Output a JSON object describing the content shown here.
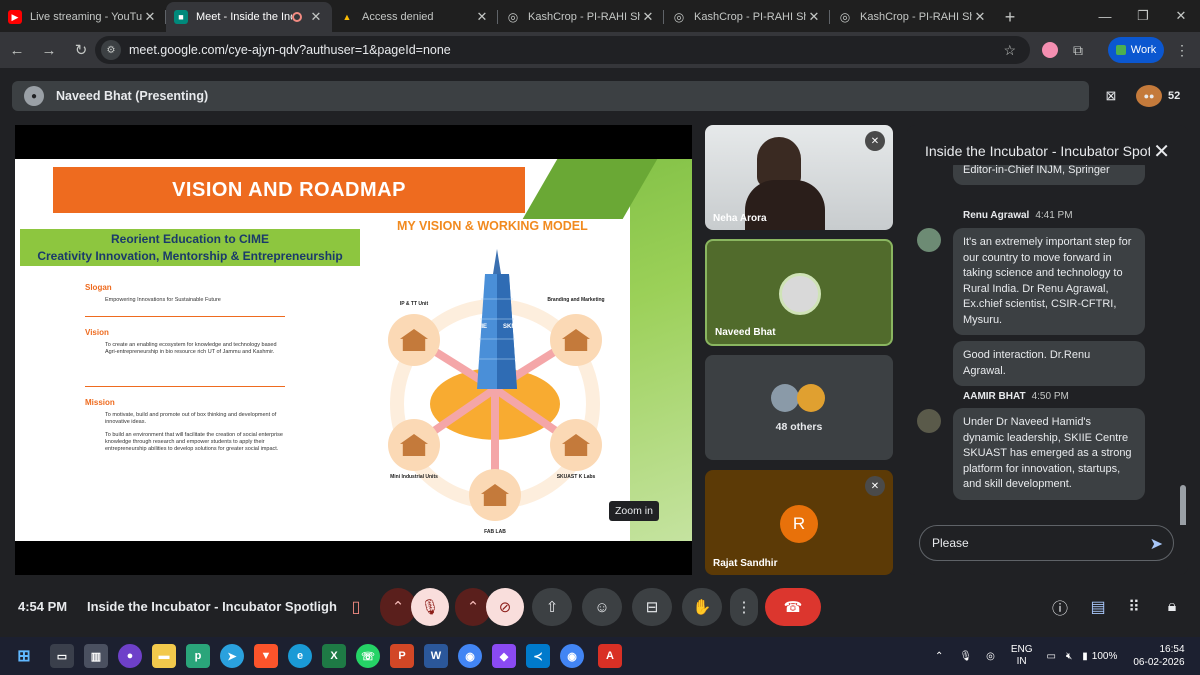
{
  "browser": {
    "tabs": [
      {
        "label": "Live streaming - YouTube Studio",
        "icon": "youtube-icon",
        "color": "#ff0000",
        "active": false
      },
      {
        "label": "Meet - Inside the Incubator",
        "icon": "meet-icon",
        "color": "#00897b",
        "active": true
      },
      {
        "label": "Access denied",
        "icon": "drive-icon",
        "color": "#fbbc04",
        "active": false
      },
      {
        "label": "KashCrop - PI-RAHI Showcase",
        "icon": "globe-icon",
        "color": "#9aa0a6",
        "active": false
      },
      {
        "label": "KashCrop - PI-RAHI Showcase",
        "icon": "globe-icon",
        "color": "#9aa0a6",
        "active": false
      },
      {
        "label": "KashCrop - PI-RAHI Showcase",
        "icon": "globe-icon",
        "color": "#9aa0a6",
        "active": false
      }
    ],
    "url": "meet.google.com/cye-ajyn-qdv?authuser=1&pageId=none",
    "profile_label": "Work"
  },
  "presenter_bar": {
    "label": "Naveed Bhat (Presenting)",
    "participant_count": "52"
  },
  "slide": {
    "title": "VISION AND ROADMAP",
    "green_line1": "Reorient Education to CIME",
    "green_line2": "Creativity Innovation, Mentorship & Entrepreneurship",
    "model_title": "MY VISION & WORKING MODEL",
    "slogan_heading": "Slogan",
    "slogan_text": "Empowering Innovations for Sustainable Future",
    "vision_heading": "Vision",
    "vision_text": "To create an enabling ecosystem for knowledge and technology based Agri-entrepreneurship in bio resource rich UT of Jammu and Kashmir.",
    "mission_heading": "Mission",
    "mission_text1": "To motivate, build and promote out of box thinking and development of innovative ideas.",
    "mission_text2": "To build an environment that will facilitate the creation of social enterprise knowledge through research and empower students to apply their entrepreneurship abilities to develop solutions for greater social impact.",
    "nodes": [
      "IP & TT Unit",
      "Branding and Marketing",
      "Mini Industrial Units",
      "SKUAST K Labs",
      "FAB LAB"
    ],
    "tower_label_left": "SKIE",
    "tower_label_right": "SKIE",
    "zoom_tooltip": "Zoom in"
  },
  "tiles": {
    "neha": "Neha Arora",
    "naveed": "Naveed Bhat",
    "others": "48 others",
    "rajat": "Rajat Sandhir",
    "rajat_initial": "R"
  },
  "chat": {
    "title": "Inside the Incubator - Incubator Spotlight",
    "prev_tail": "Editor-in-Chief INJM, Springer",
    "messages": [
      {
        "sender": "Renu Agrawal",
        "time": "4:41 PM",
        "text": "It's an extremely important step for our country to move forward in taking science and technology to Rural India. Dr Renu Agrawal, Ex.chief scientist,  CSIR-CFTRI, Mysuru."
      },
      {
        "sender": "",
        "time": "",
        "text": "Good interaction. Dr.Renu Agrawal."
      },
      {
        "sender": "AAMIR BHAT",
        "time": "4:50 PM",
        "text": "Under Dr Naveed Hamid's dynamic leadership, SKIIE Centre SKUAST has emerged as a strong platform for innovation, startups, and skill development."
      }
    ],
    "input_value": "Please"
  },
  "controls": {
    "time": "4:54 PM",
    "meeting_title": "Inside the Incubator - Incubator Spotlight"
  },
  "taskbar": {
    "lang1": "ENG",
    "lang2": "IN",
    "battery": "100%",
    "time": "16:54",
    "date": "06-02-2026"
  }
}
